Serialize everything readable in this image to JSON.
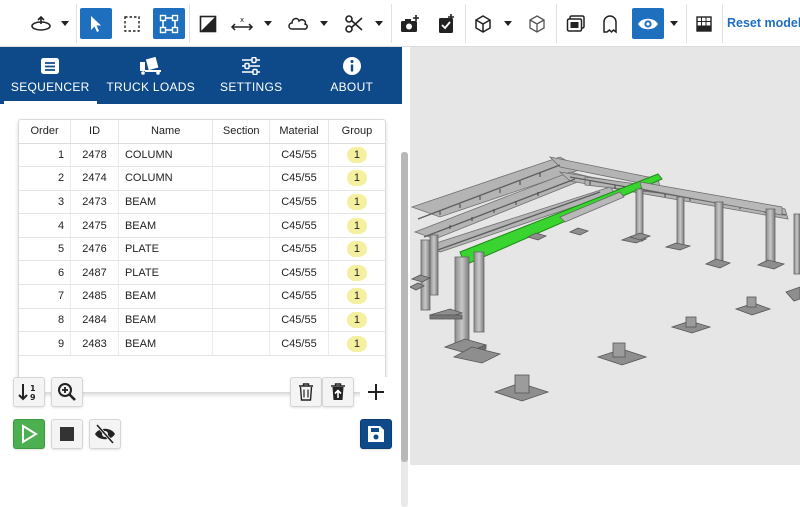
{
  "toolbar": {
    "reset_label": "Reset model",
    "icons": [
      "orbit-icon",
      "select-pointer-icon",
      "box-select-icon",
      "fit-frame-icon",
      "section-icon",
      "axis-move-icon",
      "cloud-icon",
      "cut-icon",
      "camera-add-icon",
      "clipboard-check-icon",
      "cube-icon",
      "cube-outline-icon",
      "sticker-icon",
      "ghost-icon",
      "eye-icon",
      "grid-icon"
    ]
  },
  "tabs": [
    {
      "label": "SEQUENCER",
      "icon": "list-icon",
      "active": true
    },
    {
      "label": "TRUCK LOADS",
      "icon": "truck-icon",
      "active": false
    },
    {
      "label": "SETTINGS",
      "icon": "sliders-icon",
      "active": false
    },
    {
      "label": "ABOUT",
      "icon": "info-icon",
      "active": false
    }
  ],
  "table": {
    "headers": [
      "Order",
      "ID",
      "Name",
      "Section",
      "Material",
      "Group"
    ],
    "rows": [
      {
        "order": "1",
        "id": "2478",
        "name": "COLUMN",
        "section": "",
        "material": "C45/55",
        "group": "1"
      },
      {
        "order": "2",
        "id": "2474",
        "name": "COLUMN",
        "section": "",
        "material": "C45/55",
        "group": "1"
      },
      {
        "order": "3",
        "id": "2473",
        "name": "BEAM",
        "section": "",
        "material": "C45/55",
        "group": "1"
      },
      {
        "order": "4",
        "id": "2475",
        "name": "BEAM",
        "section": "",
        "material": "C45/55",
        "group": "1"
      },
      {
        "order": "5",
        "id": "2476",
        "name": "PLATE",
        "section": "",
        "material": "C45/55",
        "group": "1"
      },
      {
        "order": "6",
        "id": "2487",
        "name": "PLATE",
        "section": "",
        "material": "C45/55",
        "group": "1"
      },
      {
        "order": "7",
        "id": "2485",
        "name": "BEAM",
        "section": "",
        "material": "C45/55",
        "group": "1"
      },
      {
        "order": "8",
        "id": "2484",
        "name": "BEAM",
        "section": "",
        "material": "C45/55",
        "group": "1"
      },
      {
        "order": "9",
        "id": "2483",
        "name": "BEAM",
        "section": "",
        "material": "C45/55",
        "group": "1"
      }
    ]
  },
  "colors": {
    "accent": "#1f6fbf",
    "tab_bar": "#0e4a8a",
    "badge": "#f5f0a0",
    "play": "#4caf50",
    "highlight_beam": "#39d42f",
    "viewport_bg": "#e6e6e6"
  }
}
